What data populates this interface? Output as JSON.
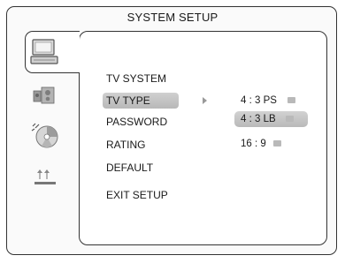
{
  "header": {
    "title": "SYSTEM SETUP"
  },
  "sidebar": {
    "tabs": [
      {
        "icon": "monitor-icon",
        "active": true
      },
      {
        "icon": "speaker-icon",
        "active": false
      },
      {
        "icon": "disc-icon",
        "active": false
      },
      {
        "icon": "settings-bars-icon",
        "active": false
      }
    ]
  },
  "menu": {
    "items": [
      "TV SYSTEM",
      "TV TYPE",
      "PASSWORD",
      "RATING",
      "DEFAULT",
      "EXIT SETUP"
    ],
    "selected": "TV TYPE"
  },
  "options": {
    "items": [
      "4 : 3 PS",
      "4 : 3 LB",
      "16 : 9"
    ],
    "highlighted": "4 : 3 LB"
  },
  "colors": {
    "highlight": "#c4c4c4",
    "border": "#333333",
    "icon_gray": "#a0a0a0"
  }
}
